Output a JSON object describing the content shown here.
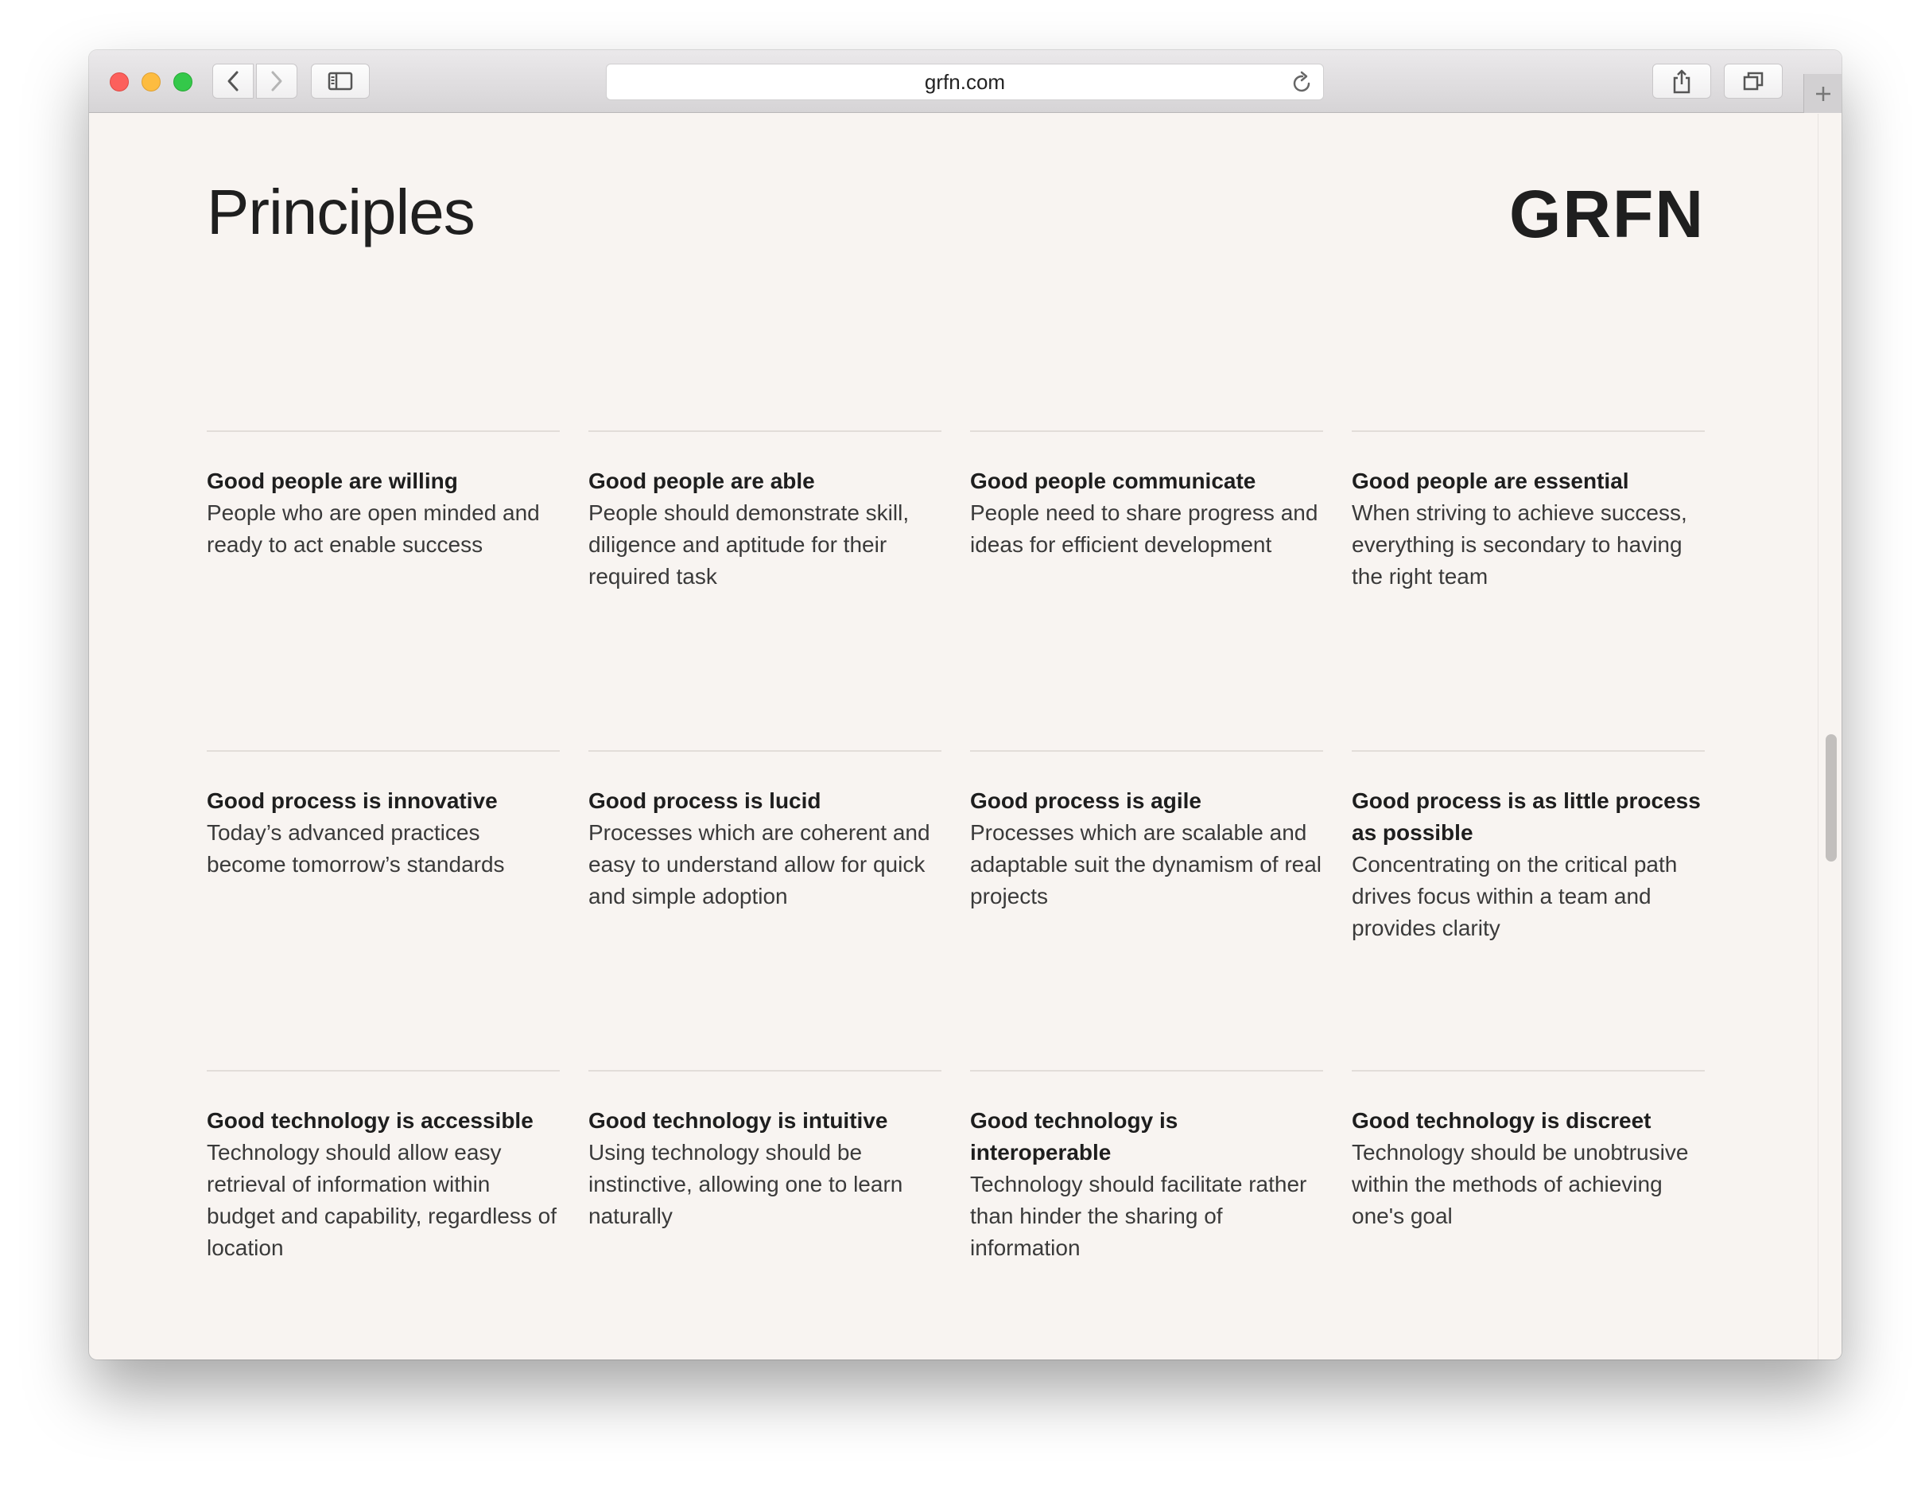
{
  "browser": {
    "url": "grfn.com"
  },
  "page": {
    "title": "Principles",
    "logo": "GRFN"
  },
  "principles": [
    {
      "title": "Good people are willing",
      "text": "People who are open minded and ready to act enable success"
    },
    {
      "title": "Good people are able",
      "text": "People should demonstrate skill, diligence and aptitude for their required task"
    },
    {
      "title": "Good people communicate",
      "text": "People need to share progress and ideas for efficient development"
    },
    {
      "title": "Good people are essential",
      "text": "When striving to achieve success, everything is secondary to having the right team"
    },
    {
      "title": "Good process is innovative",
      "text": "Today’s advanced practices become tomorrow’s standards"
    },
    {
      "title": "Good process is lucid",
      "text": "Processes which are coherent and easy to understand allow for quick and simple adoption"
    },
    {
      "title": "Good process is agile",
      "text": "Processes which are scalable and adaptable suit the dynamism of real projects"
    },
    {
      "title": "Good process is as little process as possible",
      "text": "Concentrating on the critical path drives focus within a team and provides clarity"
    },
    {
      "title": "Good technology is accessible",
      "text": "Technology should allow easy retrieval of information within budget and capability, regardless of location"
    },
    {
      "title": "Good technology is intuitive",
      "text": "Using technology should be instinctive, allowing one to learn naturally"
    },
    {
      "title": "Good technology is interoperable",
      "text": "Technology should facilitate rather than hinder the sharing of information"
    },
    {
      "title": "Good technology is discreet",
      "text": "Technology should be unobtrusive within the methods of achieving one's goal"
    }
  ],
  "icons": {
    "back": "chevron-left-icon",
    "forward": "chevron-right-icon",
    "sidebar": "sidebar-icon",
    "reload": "reload-icon",
    "share": "share-icon",
    "tabs": "tabs-icon",
    "new_tab": "plus-icon"
  },
  "colors": {
    "page_background": "#f8f4f1",
    "text": "#1f1f1f",
    "divider": "#e2ddd9",
    "close": "#fc605c",
    "minimize": "#fdbc40",
    "zoom": "#34c84a"
  }
}
